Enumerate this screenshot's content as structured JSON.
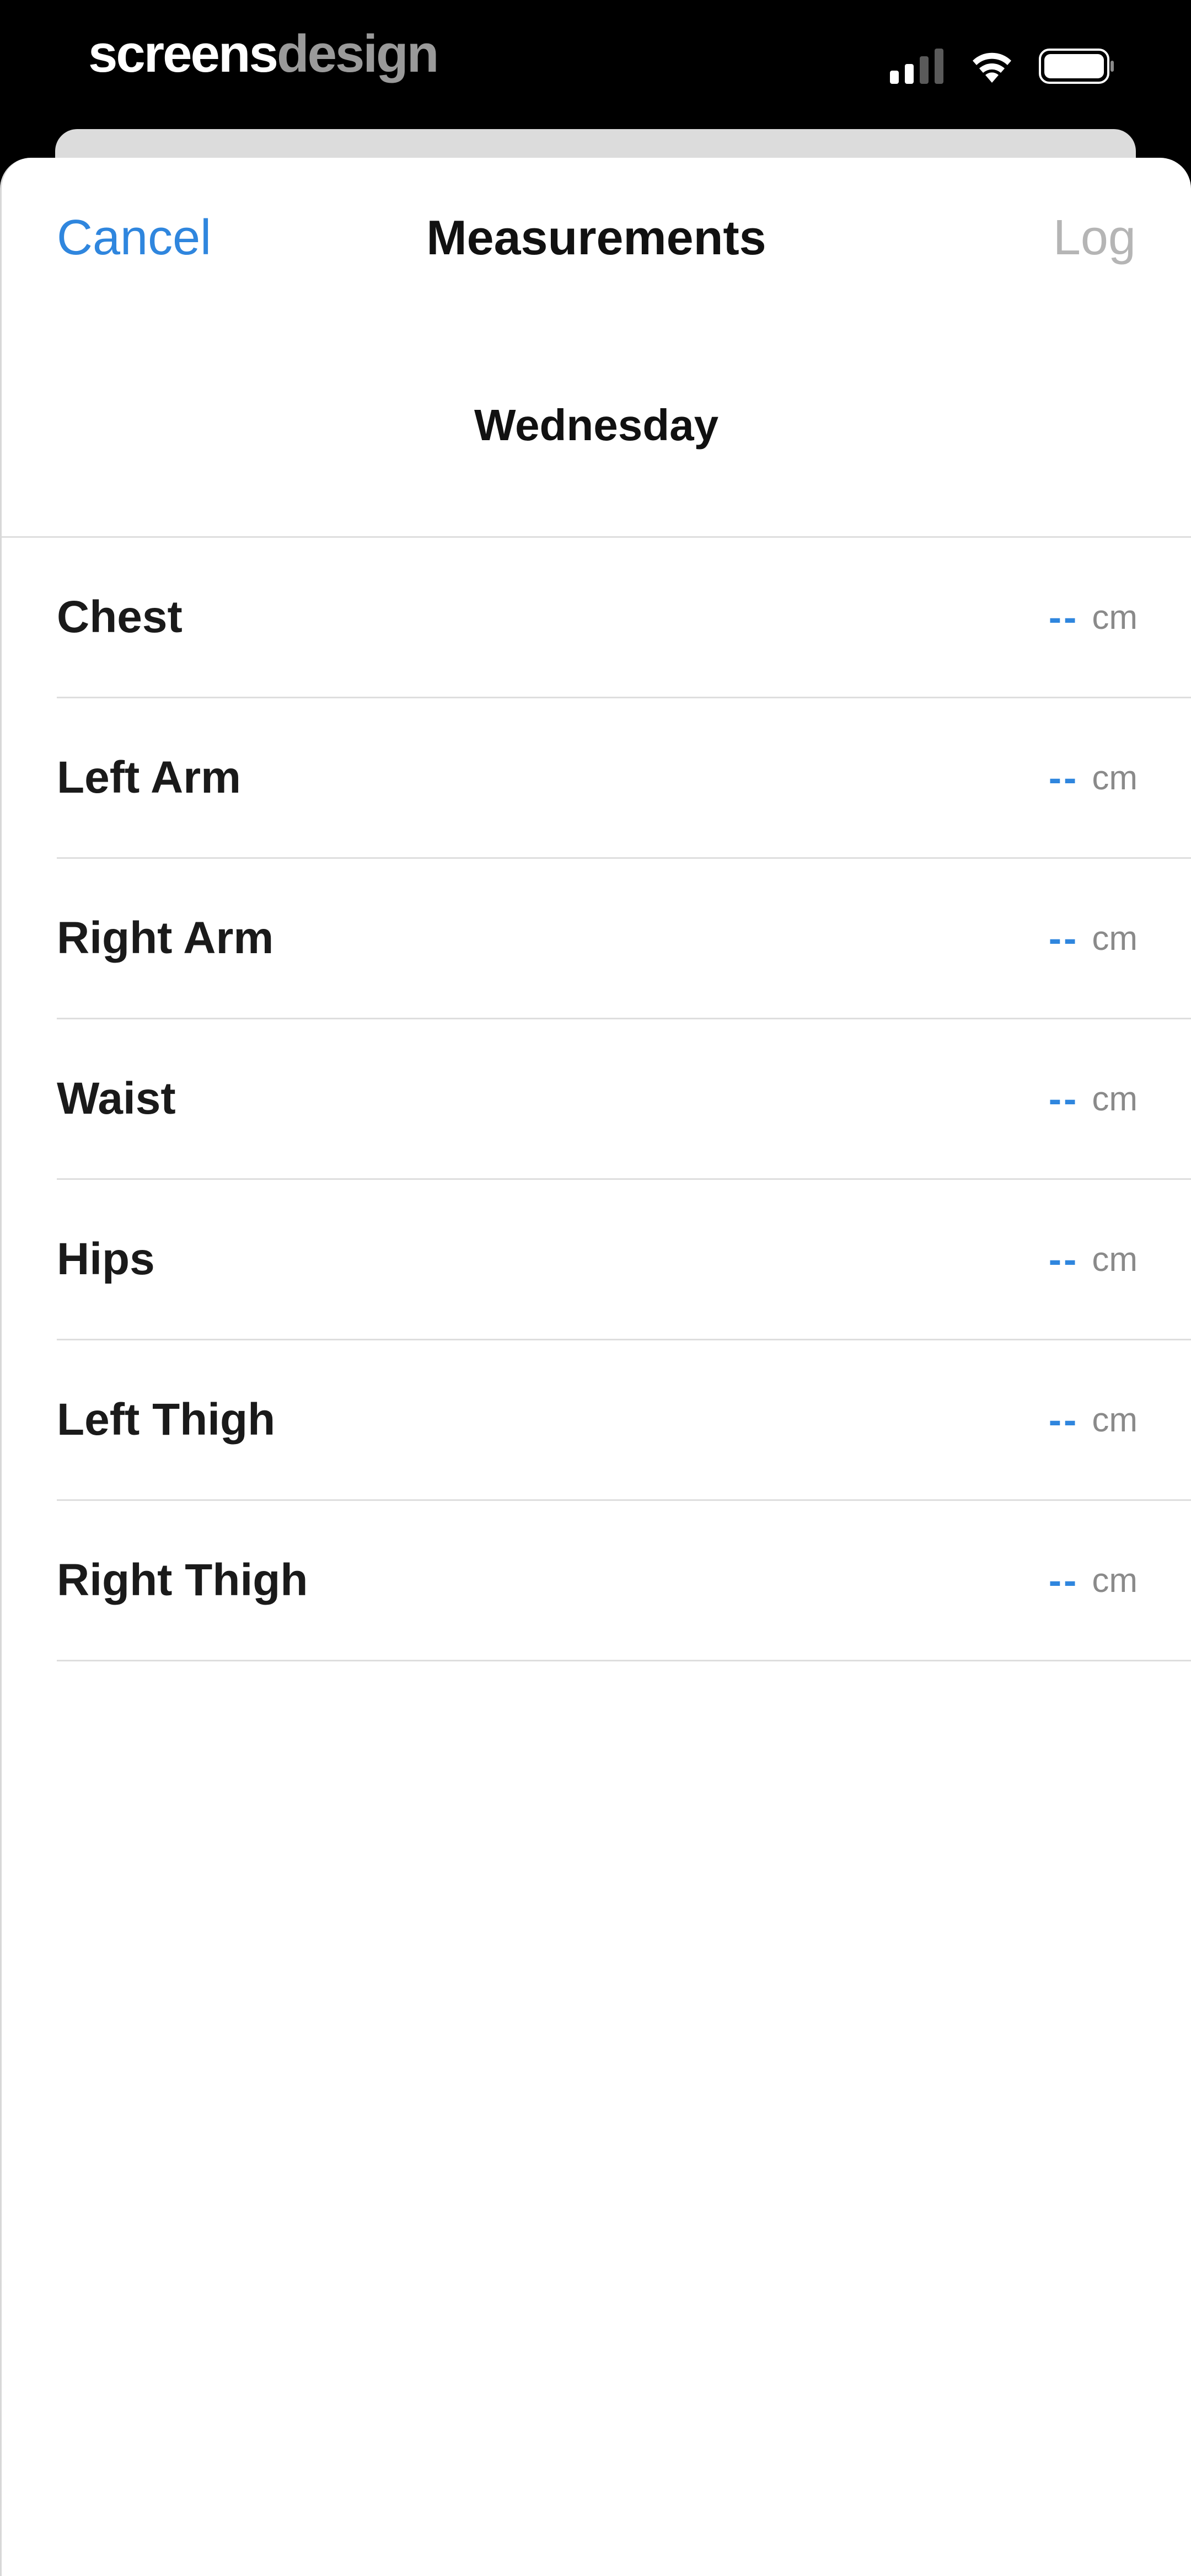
{
  "status_bar": {
    "brand_primary": "screens",
    "brand_secondary": "design",
    "signal_icon": "cellular-signal-icon",
    "wifi_icon": "wifi-icon",
    "battery_icon": "battery-icon"
  },
  "nav": {
    "cancel_label": "Cancel",
    "title": "Measurements",
    "log_label": "Log"
  },
  "date": {
    "label": "Wednesday"
  },
  "measurements": [
    {
      "label": "Chest",
      "value": "--",
      "unit": "cm"
    },
    {
      "label": "Left Arm",
      "value": "--",
      "unit": "cm"
    },
    {
      "label": "Right Arm",
      "value": "--",
      "unit": "cm"
    },
    {
      "label": "Waist",
      "value": "--",
      "unit": "cm"
    },
    {
      "label": "Hips",
      "value": "--",
      "unit": "cm"
    },
    {
      "label": "Left Thigh",
      "value": "--",
      "unit": "cm"
    },
    {
      "label": "Right Thigh",
      "value": "--",
      "unit": "cm"
    }
  ],
  "colors": {
    "accent": "#2f86de",
    "disabled": "#b5b5b5",
    "divider": "#dedede",
    "text": "#111111",
    "unit": "#8a8a8a"
  }
}
